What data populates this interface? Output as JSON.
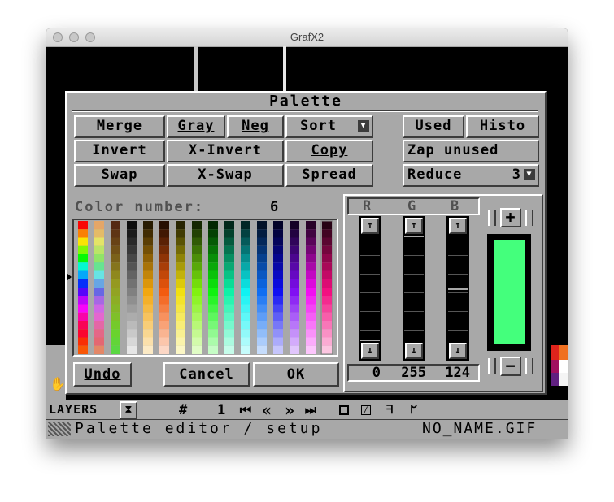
{
  "window": {
    "title": "GrafX2"
  },
  "dialog": {
    "title": "Palette",
    "buttons": {
      "merge": "Merge",
      "gray": "Gray",
      "neg": "Neg",
      "sort": "Sort",
      "used": "Used",
      "histo": "Histo",
      "invert": "Invert",
      "xinvert": "X-Invert",
      "copy": "Copy",
      "zap_unused": "Zap unused",
      "swap": "Swap",
      "xswap": "X-Swap",
      "spread": "Spread",
      "reduce": "Reduce",
      "reduce_value": "3"
    },
    "color_number_label": "Color number:",
    "color_number_value": "6",
    "channels": {
      "r": "R",
      "g": "G",
      "b": "B"
    },
    "values": {
      "r": "0",
      "g": "255",
      "b": "124"
    },
    "slider_levels": {
      "r": 0,
      "g": 1.0,
      "b": 0.49
    },
    "selected_color": "#44ff7c",
    "plus_label": "+",
    "minus_label": "−",
    "up_arrow": "↑",
    "down_arrow": "↓",
    "undo": "Undo",
    "cancel": "Cancel",
    "ok": "OK"
  },
  "statusbar": {
    "layers_label": "LAYERS",
    "layer_number_prefix": "#",
    "layer_number": "1",
    "nav_first": "⏮",
    "nav_prev": "«",
    "nav_next": "»",
    "nav_last": "⏭",
    "message": "Palette editor / setup",
    "filename": "NO_NAME.GIF"
  }
}
